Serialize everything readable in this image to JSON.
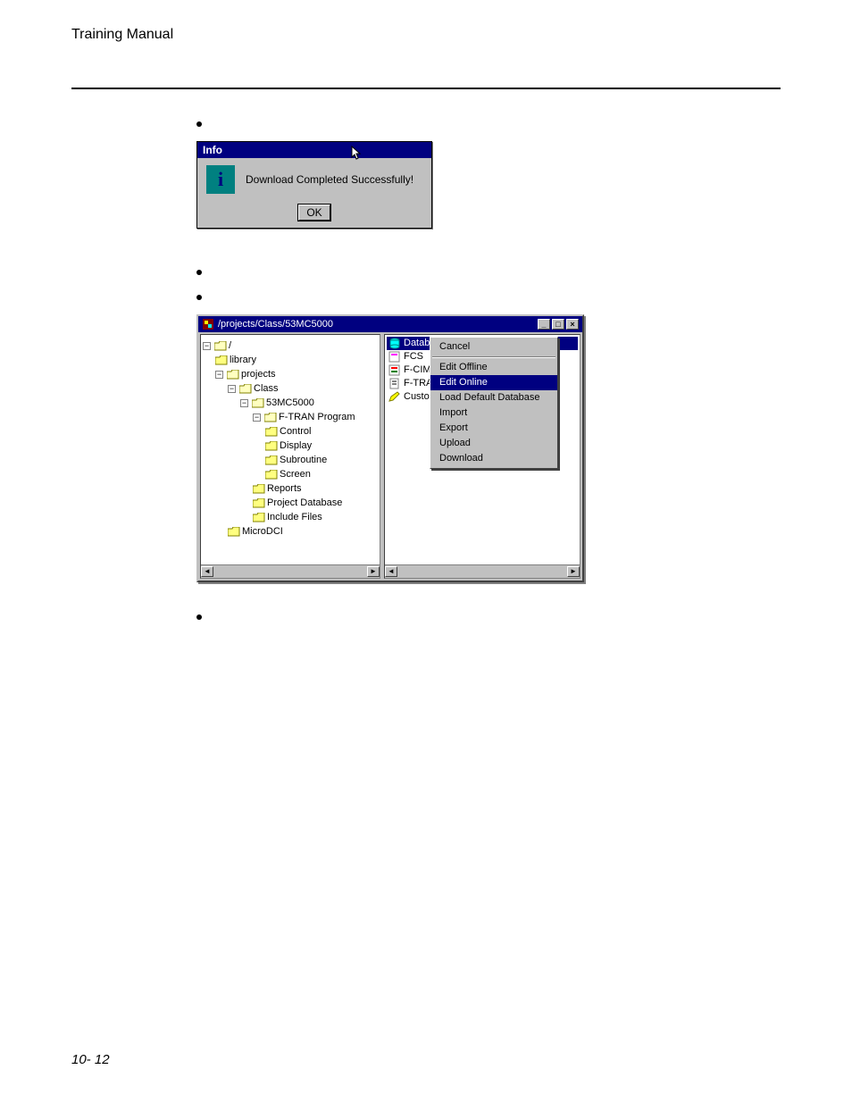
{
  "header": "Training Manual",
  "footer": "10- 12",
  "info_dialog": {
    "title": "Info",
    "message": "Download Completed Successfully!",
    "ok": "OK"
  },
  "explorer": {
    "title": "/projects/Class/53MC5000",
    "winbtns": {
      "min": "_",
      "max": "□",
      "close": "×"
    },
    "tree": {
      "root": "/",
      "library": "library",
      "projects": "projects",
      "class": "Class",
      "mc": "53MC5000",
      "ftran": "F-TRAN Program",
      "control": "Control",
      "display": "Display",
      "subroutine": "Subroutine",
      "screen": "Screen",
      "reports": "Reports",
      "projdb": "Project Database",
      "incfiles": "Include Files",
      "microdci": "MicroDCI"
    },
    "right": {
      "datab": "Datab",
      "fcs": "FCS",
      "fcim": "F-CIM",
      "ftra": "F-TRA",
      "custo": "Custo"
    },
    "menu": {
      "cancel": "Cancel",
      "edit_offline": "Edit Offline",
      "edit_online": "Edit Online",
      "load_default": "Load Default Database",
      "import": "Import",
      "export": "Export",
      "upload": "Upload",
      "download": "Download"
    },
    "scroll": {
      "left": "◄",
      "right": "►"
    }
  }
}
